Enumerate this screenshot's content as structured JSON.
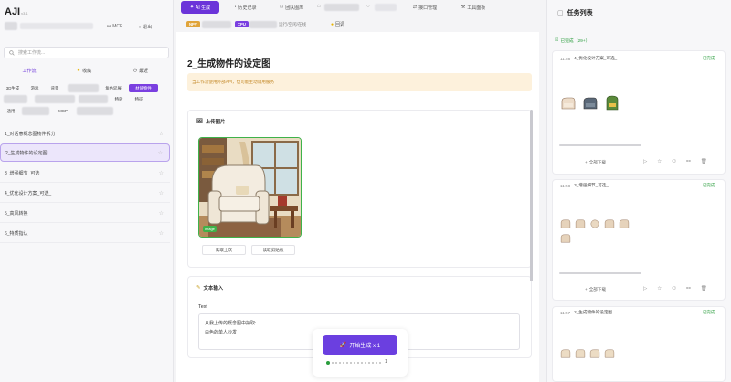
{
  "app": {
    "name": "AJI",
    "version": "v3.1"
  },
  "sidebar": {
    "header_links": [
      {
        "label": "MCP",
        "icon": "link-icon"
      },
      {
        "label": "退出",
        "icon": "logout-icon"
      }
    ],
    "search_placeholder": "搜索工作流...",
    "tabs": [
      {
        "label": "工作流",
        "icon": ""
      },
      {
        "label": "收藏",
        "icon": "star-icon"
      },
      {
        "label": "最近",
        "icon": "clock-icon"
      }
    ],
    "chips_row1": [
      "3D生成",
      "游戏",
      "背景",
      "角色延展",
      "材质物件"
    ],
    "chips_row2": [
      "特效",
      "特征"
    ],
    "chips_row3": [
      "通用",
      "MCP"
    ],
    "items": [
      "1_对话意概念图物件拆分",
      "2_生成物件的设定图",
      "3_增强细节_可选_",
      "4_优化设计方案_可选_",
      "5_高风转换",
      "6_特质指认"
    ]
  },
  "topbar": {
    "tabs": [
      {
        "label": "AI 生成",
        "icon": "sparkle-icon"
      },
      {
        "label": "历史记录",
        "icon": "history-icon"
      },
      {
        "label": "团队图库",
        "icon": "team-icon"
      },
      {
        "label": "接口管理",
        "icon": "api-icon"
      },
      {
        "label": "工具面板",
        "icon": "tool-icon"
      }
    ],
    "badges": [
      {
        "label": "NPV",
        "color": "#e0a43a"
      },
      {
        "label": "CPU",
        "color": "#7a3fe0"
      }
    ],
    "status_text": "运行/空闲/在线",
    "status_extra": "回调"
  },
  "main": {
    "title": "2_生成物件的设定图",
    "hint": "当工作流使用外部API，但可能主动调用服务",
    "upload": {
      "heading": "上传图片",
      "image_tag": "image",
      "buttons": [
        "读取上次",
        "读取剪贴板"
      ]
    },
    "text_input": {
      "heading": "文本输入",
      "field_label": "Text",
      "lines": [
        "从我上传的概念图中抽取:",
        "白色的单人沙发"
      ]
    },
    "generate": {
      "label": "开始生成 x 1",
      "counter": "1"
    }
  },
  "tasks": {
    "title": "任务列表",
    "completed_label": "已完成（29+）",
    "cards": [
      {
        "time": "11:58",
        "name": "4_优化设计方案_可选_",
        "status": "已完成",
        "action": "全部下载"
      },
      {
        "time": "11:58",
        "name": "3_增强细节_可选_",
        "status": "已完成",
        "action": "全部下载"
      },
      {
        "time": "11:57",
        "name": "2_生成物件的设定图",
        "status": "已完成",
        "action": ""
      }
    ]
  },
  "colors": {
    "accent": "#6b34d9",
    "done": "#2a9d3d",
    "hint_bg": "#fdf1dc"
  }
}
